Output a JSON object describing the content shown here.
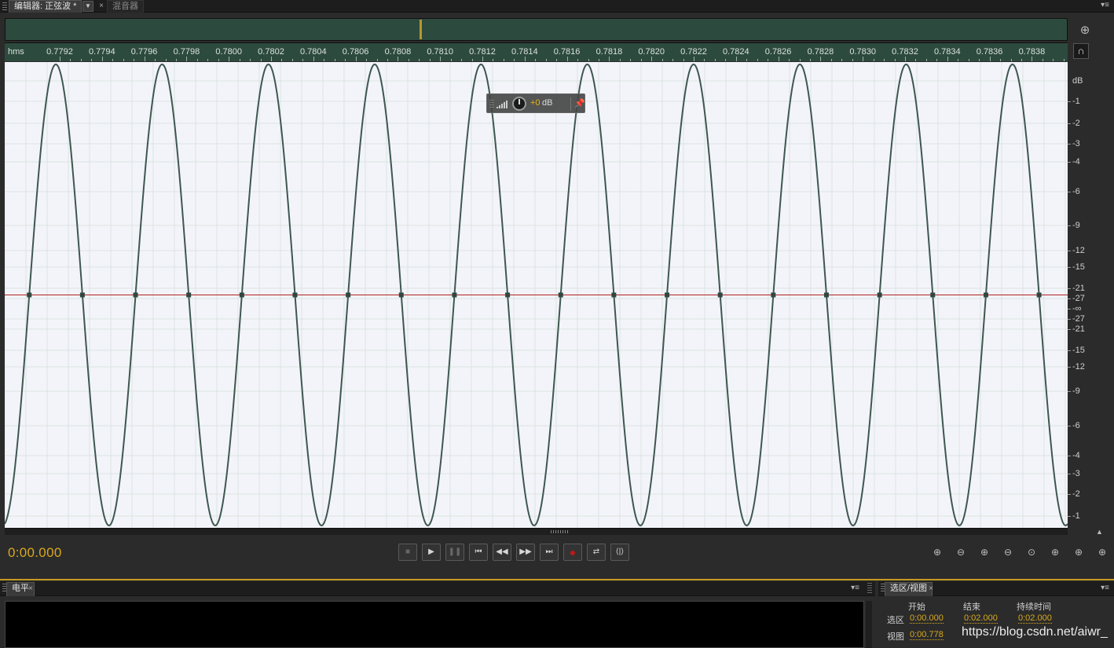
{
  "tabs": {
    "editor_tab": "编辑器: 正弦波 *",
    "editor_close": "×",
    "mixer_tab": "混音器",
    "dropdown_arrow": "▼",
    "panel_menu": "▾≡"
  },
  "ruler": {
    "unit": "hms",
    "labels": [
      "0.7792",
      "0.7794",
      "0.7796",
      "0.7798",
      "0.7800",
      "0.7802",
      "0.7804",
      "0.7806",
      "0.7808",
      "0.7810",
      "0.7812",
      "0.7814",
      "0.7816",
      "0.7818",
      "0.7820",
      "0.7822",
      "0.7824",
      "0.7826",
      "0.7828",
      "0.7830",
      "0.7832",
      "0.7834",
      "0.7836",
      "0.7838"
    ]
  },
  "db_scale": {
    "labels": [
      "dB",
      "-1",
      "-2",
      "-3",
      "-4",
      "-6",
      "-9",
      "-12",
      "-15",
      "-21",
      "-27",
      "-∞",
      "-27",
      "-21",
      "-15",
      "-12",
      "-9",
      "-6",
      "-4",
      "-3",
      "-2",
      "-1"
    ]
  },
  "waveform": {
    "type": "sine",
    "view_start_s": 0.779,
    "view_end_s": 0.784,
    "frequency_hz": 2000,
    "colors": {
      "wave": "#3e5750",
      "center_line": "#b02020",
      "background": "#f3f4fa",
      "grid": "#dbe3df"
    }
  },
  "hud": {
    "value": "+0",
    "unit": "dB",
    "pin_icon": "pin-icon"
  },
  "transport": {
    "timecode": "0:00.000",
    "buttons": [
      {
        "name": "stop-button",
        "glyph": "■"
      },
      {
        "name": "play-button",
        "glyph": "▶"
      },
      {
        "name": "pause-button",
        "glyph": "❚❚"
      },
      {
        "name": "go-to-start-button",
        "glyph": "⏮"
      },
      {
        "name": "rewind-button",
        "glyph": "◀◀"
      },
      {
        "name": "fast-forward-button",
        "glyph": "▶▶"
      },
      {
        "name": "go-to-end-button",
        "glyph": "⏭"
      },
      {
        "name": "record-button",
        "glyph": "●"
      },
      {
        "name": "loop-playback-button",
        "glyph": "⇄"
      },
      {
        "name": "skip-selection-button",
        "glyph": "⟨|⟩"
      }
    ],
    "zoom_buttons": [
      "zoom-in-amplitude",
      "zoom-out-amplitude",
      "zoom-in-time",
      "zoom-out-time",
      "zoom-out-full",
      "zoom-in-selection-start",
      "zoom-in-selection-end",
      "zoom-to-selection"
    ]
  },
  "level_panel": {
    "tab": "电平",
    "close": "×",
    "menu": "▾≡"
  },
  "selection_panel": {
    "tab": "选区/视图",
    "close": "×",
    "menu": "▾≡",
    "headers": {
      "start": "开始",
      "end": "结束",
      "duration": "持续时间"
    },
    "rows": [
      {
        "label": "选区",
        "start": "0:00.000",
        "end": "0:02.000",
        "duration": "0:02.000"
      },
      {
        "label": "视图",
        "start": "0:00.778",
        "end": "",
        "duration": ""
      }
    ]
  },
  "watermark": "https://blog.csdn.net/aiwr_"
}
